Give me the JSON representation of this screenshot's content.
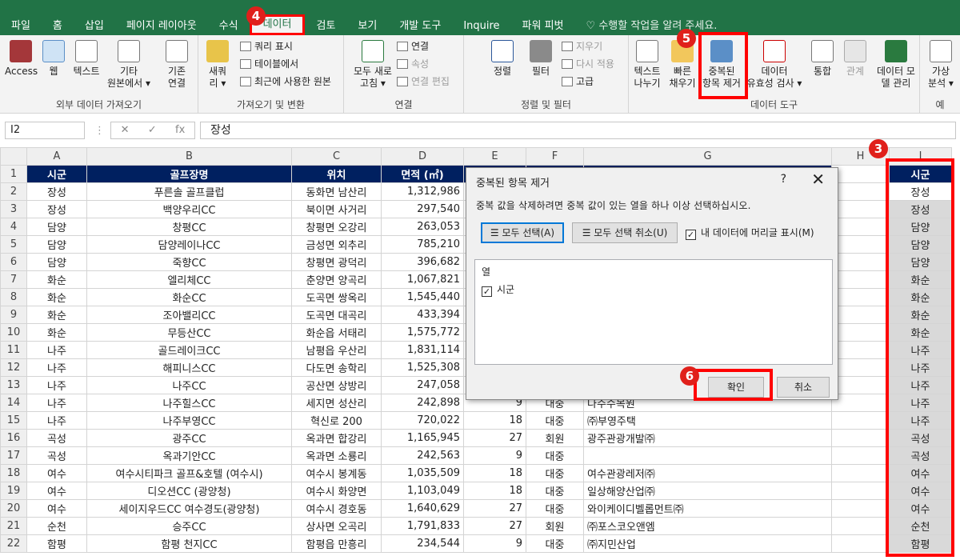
{
  "tabs": [
    "파일",
    "홈",
    "삽입",
    "페이지 레이아웃",
    "수식",
    "데이터",
    "검토",
    "보기",
    "개발 도구",
    "Inquire",
    "파워 피벗",
    "수행할 작업을 알려 주세요."
  ],
  "ribbon": {
    "groups": [
      "외부 데이터 가져오기",
      "가져오기 및 변환",
      "연결",
      "정렬 및 필터",
      "데이터 도구",
      "예"
    ],
    "ext": [
      {
        "l1": "Access",
        "l2": ""
      },
      {
        "l1": "웹",
        "l2": ""
      },
      {
        "l1": "텍스트",
        "l2": ""
      },
      {
        "l1": "기타",
        "l2": "원본에서 ▾"
      },
      {
        "l1": "기존",
        "l2": "연결"
      }
    ],
    "newquery": {
      "l1": "새쿼",
      "l2": "리 ▾"
    },
    "getsmall": [
      "쿼리 표시",
      "테이블에서",
      "최근에 사용한 원본"
    ],
    "refresh": {
      "l1": "모두 새로",
      "l2": "고침 ▾"
    },
    "connsmall": [
      "연결",
      "속성",
      "연결 편집"
    ],
    "sort": "정렬",
    "filter": "필터",
    "filtersmall": [
      "지우기",
      "다시 적용",
      "고급"
    ],
    "tools": [
      {
        "l1": "텍스트",
        "l2": "나누기"
      },
      {
        "l1": "빠른",
        "l2": "채우기"
      },
      {
        "l1": "중복된",
        "l2": "항목 제거"
      },
      {
        "l1": "데이터",
        "l2": "유효성 검사 ▾"
      },
      {
        "l1": "통합",
        "l2": ""
      },
      {
        "l1": "관계",
        "l2": ""
      },
      {
        "l1": "데이터 모",
        "l2": "델 관리"
      },
      {
        "l1": "가상",
        "l2": "분석 ▾"
      }
    ]
  },
  "formula": {
    "namebox": "I2",
    "fx": "fx",
    "value": "장성"
  },
  "columns": [
    "A",
    "B",
    "C",
    "D",
    "E",
    "F",
    "G",
    "H",
    "I"
  ],
  "headers": [
    "시군",
    "골프장명",
    "위치",
    "면적 (㎡)",
    "",
    "",
    "",
    "",
    "시군"
  ],
  "rows": [
    [
      "장성",
      "푸른솔 골프클럽",
      "동화면 남산리",
      "1,312,986",
      "",
      "",
      "",
      "",
      "장성"
    ],
    [
      "장성",
      "백양우리CC",
      "북이면 사거리",
      "297,540",
      "",
      "",
      "",
      "",
      "장성"
    ],
    [
      "담양",
      "창평CC",
      "창평면 오강리",
      "263,053",
      "",
      "",
      "",
      "",
      "담양"
    ],
    [
      "담양",
      "담양레이나CC",
      "금성면 외추리",
      "785,210",
      "",
      "",
      "",
      "",
      "담양"
    ],
    [
      "담양",
      "죽향CC",
      "창평면 광덕리",
      "396,682",
      "",
      "",
      "",
      "",
      "담양"
    ],
    [
      "화순",
      "엘리체CC",
      "춘양면 양곡리",
      "1,067,821",
      "",
      "",
      "",
      "",
      "화순"
    ],
    [
      "화순",
      "화순CC",
      "도곡면 쌍옥리",
      "1,545,440",
      "",
      "",
      "",
      "",
      "화순"
    ],
    [
      "화순",
      "조아밸리CC",
      "도곡면 대곡리",
      "433,394",
      "",
      "",
      "",
      "",
      "화순"
    ],
    [
      "화순",
      "무등산CC",
      "화순읍 서태리",
      "1,575,772",
      "",
      "",
      "",
      "",
      "화순"
    ],
    [
      "나주",
      "골드레이크CC",
      "남평읍 우산리",
      "1,831,114",
      "",
      "",
      "",
      "",
      "나주"
    ],
    [
      "나주",
      "해피니스CC",
      "다도면 송학리",
      "1,525,308",
      "",
      "",
      "",
      "",
      "나주"
    ],
    [
      "나주",
      "나주CC",
      "공산면 상방리",
      "247,058",
      "",
      "",
      "",
      "",
      "나주"
    ],
    [
      "나주",
      "나주힐스CC",
      "세지면 성산리",
      "242,898",
      "9",
      "대중",
      "나주수목원",
      "",
      "나주"
    ],
    [
      "나주",
      "나주부영CC",
      "혁신로 200",
      "720,022",
      "18",
      "대중",
      "㈜부영주택",
      "",
      "나주"
    ],
    [
      "곡성",
      "광주CC",
      "옥과면 합강리",
      "1,165,945",
      "27",
      "회원",
      "광주관광개발㈜",
      "",
      "곡성"
    ],
    [
      "곡성",
      "옥과기안CC",
      "옥과면 소룡리",
      "242,563",
      "9",
      "대중",
      "",
      "",
      "곡성"
    ],
    [
      "여수",
      "여수시티파크 골프&호텔 (여수시)",
      "여수시 봉계동",
      "1,035,509",
      "18",
      "대중",
      "여수관광레저㈜",
      "",
      "여수"
    ],
    [
      "여수",
      "디오션CC (광양청)",
      "여수시 화양면",
      "1,103,049",
      "18",
      "대중",
      "일상해양산업㈜",
      "",
      "여수"
    ],
    [
      "여수",
      "세이지우드CC 여수경도(광양청)",
      "여수시 경호동",
      "1,640,629",
      "27",
      "대중",
      "와이케이디벨롭먼트㈜",
      "",
      "여수"
    ],
    [
      "순천",
      "승주CC",
      "상사면 오곡리",
      "1,791,833",
      "27",
      "회원",
      "㈜포스코오앤엠",
      "",
      "순천"
    ],
    [
      "함평",
      "함평 천지CC",
      "함평읍 만흥리",
      "234,544",
      "9",
      "대중",
      "㈜지민산업",
      "",
      "함평"
    ]
  ],
  "dialog": {
    "title": "중복된 항목 제거",
    "help": "?",
    "close": "✕",
    "instruction": "중복 값을 삭제하려면 중복 값이 있는 열을 하나 이상 선택하십시오.",
    "select_all": "모두 선택(A)",
    "unselect_all": "모두 선택 취소(U)",
    "has_headers": "내 데이터에 머리글 표시(M)",
    "col_header": "열",
    "col_item": "시군",
    "ok": "확인",
    "cancel": "취소"
  },
  "badges": [
    "4",
    "5",
    "3",
    "6"
  ],
  "colors": {
    "excel_green": "#217346",
    "header_navy": "#002060",
    "annotation_red": "#ff0000"
  }
}
